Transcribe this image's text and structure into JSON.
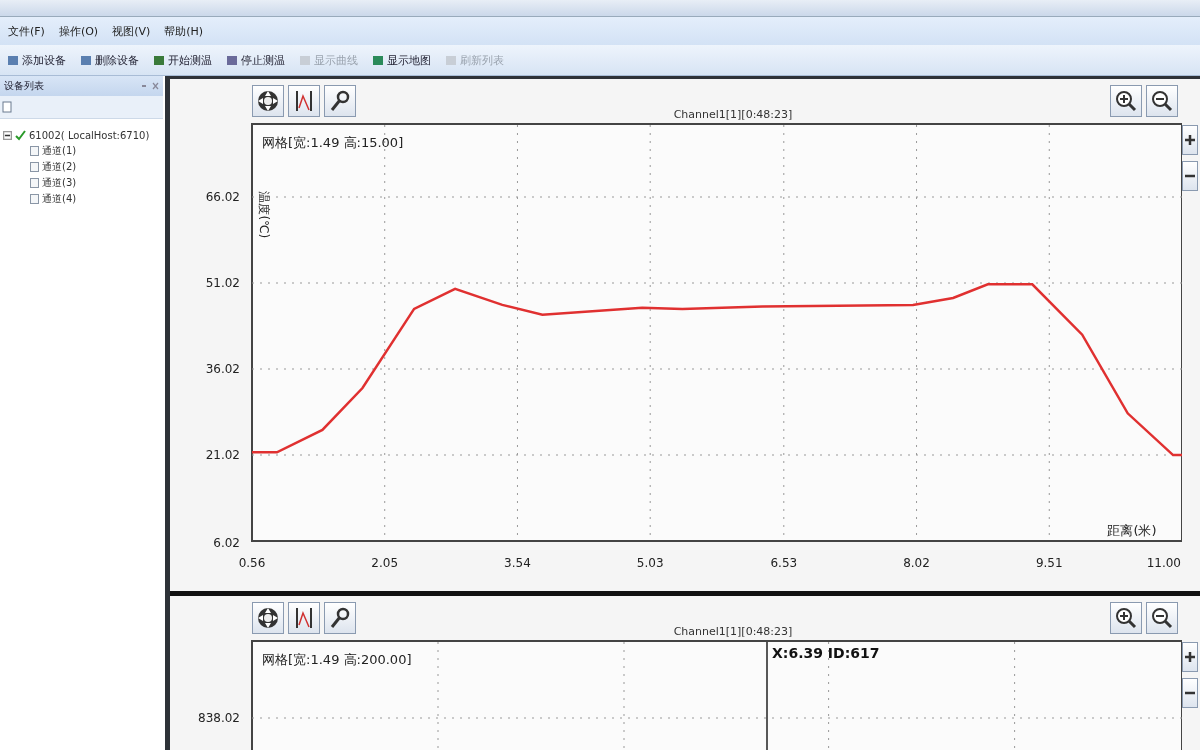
{
  "menu": [
    {
      "label": "文件(F)"
    },
    {
      "label": "操作(O)"
    },
    {
      "label": "视图(V)"
    },
    {
      "label": "帮助(H)"
    }
  ],
  "toolbar": [
    {
      "label": "添加设备",
      "disabled": false
    },
    {
      "label": "删除设备",
      "disabled": false
    },
    {
      "label": "开始测温",
      "disabled": false
    },
    {
      "label": "停止测温",
      "disabled": false
    },
    {
      "label": "显示曲线",
      "disabled": true
    },
    {
      "label": "显示地图",
      "disabled": false
    },
    {
      "label": "刷新列表",
      "disabled": true
    }
  ],
  "device_panel": {
    "title": "设备列表",
    "tree": [
      {
        "label": "61002( LocalHost:6710)",
        "checked": true,
        "expanded": true,
        "children": [
          {
            "label": "通道(1)"
          },
          {
            "label": "通道(2)"
          },
          {
            "label": "通道(3)"
          },
          {
            "label": "通道(4)"
          }
        ]
      }
    ]
  },
  "charts": [
    {
      "title": "Channel1[1][0:48:23]",
      "grid_info": "网格[宽:1.49 高:15.00]",
      "chart_data": {
        "type": "line",
        "grid": true,
        "xlabel": "距离(米)",
        "ylabel": "温度(℃)",
        "x": [
          0.56,
          0.84,
          1.35,
          1.8,
          2.38,
          2.84,
          3.37,
          3.82,
          4.94,
          5.39,
          6.29,
          7.98,
          8.43,
          8.82,
          9.32,
          9.88,
          10.39,
          10.9,
          11.0
        ],
        "series": [
          {
            "color": "#e03030",
            "values": [
              21.5,
              21.5,
              25.4,
              32.7,
              46.5,
              50.0,
              47.2,
              45.5,
              46.7,
              46.5,
              46.9,
              47.2,
              48.4,
              50.8,
              50.8,
              42.0,
              28.3,
              21.0,
              21.0
            ]
          }
        ],
        "xlim": [
          0.56,
          11.0
        ],
        "ylim": [
          6.02,
          78.93
        ],
        "xticks": [
          0.56,
          2.05,
          3.54,
          5.03,
          6.53,
          8.02,
          9.51,
          {
            "value": 11.0,
            "label": "11.00"
          }
        ],
        "yticks": [
          6.02,
          21.02,
          36.02,
          51.02,
          66.02
        ]
      }
    },
    {
      "title": "Channel1[1][0:48:23]",
      "grid_info": "网格[宽:1.49 高:200.00]",
      "cursor": "X:6.39 ID:617",
      "y_tick": "838.02"
    }
  ]
}
